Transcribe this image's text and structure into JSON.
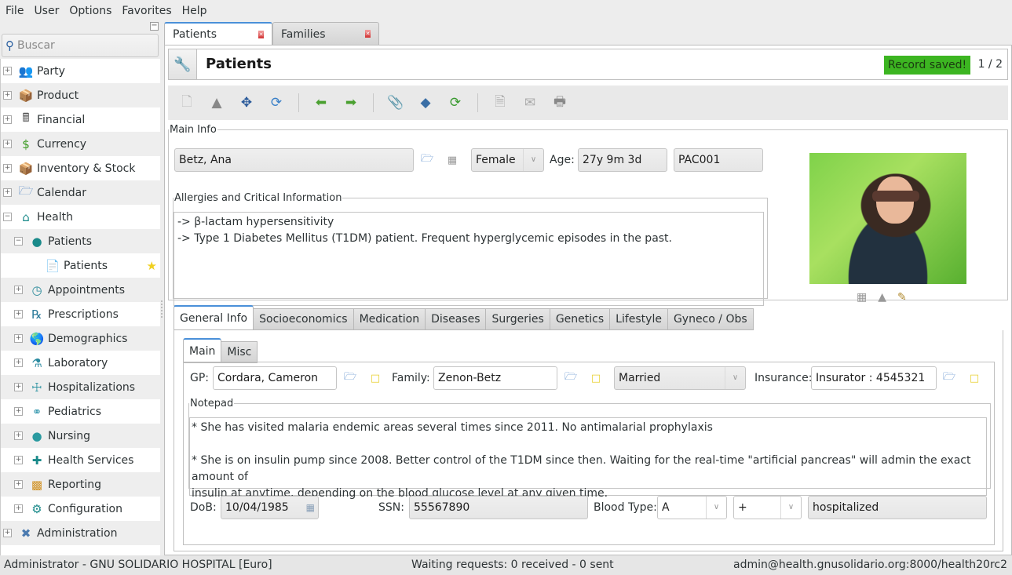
{
  "menu": [
    "File",
    "User",
    "Options",
    "Favorites",
    "Help"
  ],
  "sidebar": {
    "search_placeholder": "Buscar",
    "items": [
      {
        "label": "Party",
        "icon": "party-icon",
        "level": 0,
        "expander": "+"
      },
      {
        "label": "Product",
        "icon": "product-box-icon",
        "level": 0,
        "expander": "+"
      },
      {
        "label": "Financial",
        "icon": "calculator-icon",
        "level": 0,
        "expander": "+"
      },
      {
        "label": "Currency",
        "icon": "currency-icon",
        "level": 0,
        "expander": "+"
      },
      {
        "label": "Inventory & Stock",
        "icon": "inventory-box-icon",
        "level": 0,
        "expander": "+"
      },
      {
        "label": "Calendar",
        "icon": "calendar-folder-icon",
        "level": 0,
        "expander": "+"
      },
      {
        "label": "Health",
        "icon": "health-icon",
        "level": 0,
        "expander": "−"
      },
      {
        "label": "Patients",
        "icon": "patient-icon",
        "level": 1,
        "expander": "−"
      },
      {
        "label": "Patients",
        "icon": "document-icon",
        "level": 2,
        "expander": "",
        "favorite": true
      },
      {
        "label": "Appointments",
        "icon": "appointments-icon",
        "level": 1,
        "expander": "+"
      },
      {
        "label": "Prescriptions",
        "icon": "prescription-icon",
        "level": 1,
        "expander": "+"
      },
      {
        "label": "Demographics",
        "icon": "globe-icon",
        "level": 1,
        "expander": "+"
      },
      {
        "label": "Laboratory",
        "icon": "flask-icon",
        "level": 1,
        "expander": "+"
      },
      {
        "label": "Hospitalizations",
        "icon": "bed-icon",
        "level": 1,
        "expander": "+"
      },
      {
        "label": "Pediatrics",
        "icon": "baby-bottle-icon",
        "level": 1,
        "expander": "+"
      },
      {
        "label": "Nursing",
        "icon": "nurse-icon",
        "level": 1,
        "expander": "+"
      },
      {
        "label": "Health Services",
        "icon": "medkit-icon",
        "level": 1,
        "expander": "+"
      },
      {
        "label": "Reporting",
        "icon": "report-chart-icon",
        "level": 1,
        "expander": "+"
      },
      {
        "label": "Configuration",
        "icon": "config-icon",
        "level": 1,
        "expander": "+"
      },
      {
        "label": "Administration",
        "icon": "tools-icon",
        "level": 0,
        "expander": "+"
      }
    ]
  },
  "doc_tabs": [
    {
      "label": "Patients",
      "active": true
    },
    {
      "label": "Families",
      "active": false
    }
  ],
  "header": {
    "title": "Patients",
    "status": "Record saved!",
    "record_position": "1 / 2",
    "status_color": "#3cb521"
  },
  "toolbar": [
    "new-record-icon",
    "save-icon",
    "switch-view-icon",
    "reload-icon",
    "|",
    "previous-icon",
    "next-icon",
    "|",
    "attachment-icon",
    "action-icon",
    "relate-icon",
    "|",
    "report-icon",
    "email-icon",
    "print-icon"
  ],
  "main_info": {
    "legend": "Main Info",
    "name": "Betz, Ana",
    "gender": "Female",
    "age_label": "Age:",
    "age": "27y 9m 3d",
    "patient_id": "PAC001",
    "allergies_legend": "Allergies and Critical Information",
    "allergies_lines": [
      "-> β-lactam hypersensitivity",
      "-> Type 1 Diabetes Mellitus (T1DM) patient. Frequent hyperglycemic episodes in the past."
    ]
  },
  "notebook": {
    "tabs": [
      "General Info",
      "Socioeconomics",
      "Medication",
      "Diseases",
      "Surgeries",
      "Genetics",
      "Lifestyle",
      "Gyneco / Obs"
    ],
    "sub_tabs": [
      "Main",
      "Misc"
    ],
    "gp_label": "GP:",
    "gp": "Cordara, Cameron",
    "family_label": "Family:",
    "family": "Zenon-Betz",
    "marital_status": "Married",
    "insurance_label": "Insurance:",
    "insurance": "Insurator : 4545321",
    "notepad_legend": "Notepad",
    "notepad_lines": [
      "* She has visited malaria endemic areas several times since 2011. No antimalarial prophylaxis",
      "",
      "* She is on insulin pump since 2008. Better control of the T1DM since then. Waiting for the real-time \"artificial pancreas\" will admin the exact amount of",
      "insulin at anytime, depending on the blood glucose level at any given time."
    ],
    "dob_label": "DoB:",
    "dob": "10/04/1985",
    "ssn_label": "SSN:",
    "ssn": "55567890",
    "blood_type_label": "Blood Type:",
    "blood_type": "A",
    "rh": "+",
    "patient_status": "hospitalized"
  },
  "statusbar": {
    "left": "Administrator - GNU SOLIDARIO HOSPITAL [Euro]",
    "center": "Waiting requests: 0 received - 0 sent",
    "right": "admin@health.gnusolidario.org:8000/health20rc2"
  }
}
